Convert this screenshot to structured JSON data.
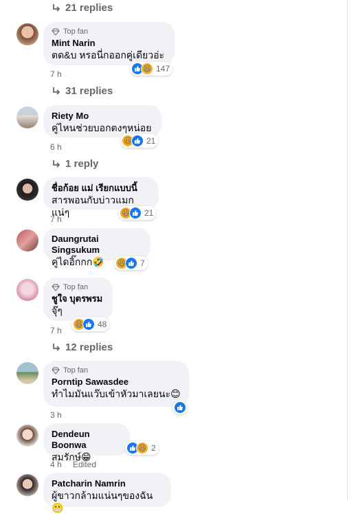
{
  "replies": [
    {
      "label": "21 replies"
    },
    {
      "label": "31 replies"
    },
    {
      "label": "1 reply"
    },
    {
      "label": "12 replies"
    }
  ],
  "comments": [
    {
      "badge": "Top fan",
      "name": "Mint Narin",
      "text": "ตด&บ หรอนี่กออกคู่เดียวอ่ะ",
      "time": "7 h",
      "reactions": "147"
    },
    {
      "badge": "",
      "name": "Riety Mo",
      "text": "คู่ไหนช่วยบอกตงๆหน่อย",
      "time": "6 h",
      "reactions": "21"
    },
    {
      "badge": "",
      "name": "ชื่อก้อย แม่ เรียกแบบนี้",
      "text": "สารพอนกับบ่าวแมกแน่ๆ",
      "time": "7 h",
      "reactions": "21"
    },
    {
      "badge": "",
      "name": "Daungrutai Singsukum",
      "text": "คู่ไดอิ๊กกก🤣",
      "time": "7 h",
      "reactions": "7"
    },
    {
      "badge": "Top fan",
      "name": "ชูใจ บุตรพรม",
      "text": "จุ๊ๆ",
      "time": "7 h",
      "reactions": "48"
    },
    {
      "badge": "Top fan",
      "name": "Porntip Sawasdee",
      "text": "ทำไมมันแว๊บเข้าหัวมาเลยนะ😊",
      "time": "3 h",
      "reactions": ""
    },
    {
      "badge": "",
      "name": "Dendeun Boonwa",
      "text": "สมรักษ์😁",
      "time": "4 h",
      "edited": "Edited",
      "reactions": "2"
    },
    {
      "badge": "",
      "name": "Patcharin Namrin",
      "text": "ผู้ขาวกล้ามแน่นๆของฉัน😬",
      "time": "",
      "reactions": ""
    }
  ],
  "colors": {
    "like": "#1877f2",
    "haha": "#f7b125",
    "meta": "#65676b",
    "bubble": "#f0f2f5"
  }
}
